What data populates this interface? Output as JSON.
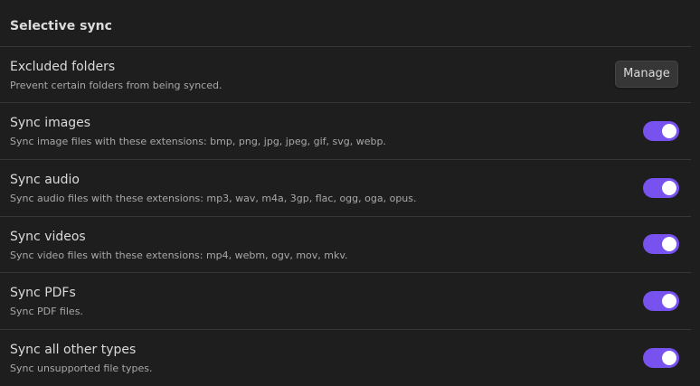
{
  "section": {
    "title": "Selective sync"
  },
  "excluded_folders": {
    "name": "Excluded folders",
    "description": "Prevent certain folders from being synced.",
    "button_label": "Manage"
  },
  "settings": [
    {
      "name": "Sync images",
      "description": "Sync image files with these extensions: bmp, png, jpg, jpeg, gif, svg, webp.",
      "enabled": true
    },
    {
      "name": "Sync audio",
      "description": "Sync audio files with these extensions: mp3, wav, m4a, 3gp, flac, ogg, oga, opus.",
      "enabled": true
    },
    {
      "name": "Sync videos",
      "description": "Sync video files with these extensions: mp4, webm, ogv, mov, mkv.",
      "enabled": true
    },
    {
      "name": "Sync PDFs",
      "description": "Sync PDF files.",
      "enabled": true
    },
    {
      "name": "Sync all other types",
      "description": "Sync unsupported file types.",
      "enabled": true
    }
  ],
  "colors": {
    "background": "#1e1e1e",
    "accent": "#7852ee",
    "divider": "#363636"
  }
}
